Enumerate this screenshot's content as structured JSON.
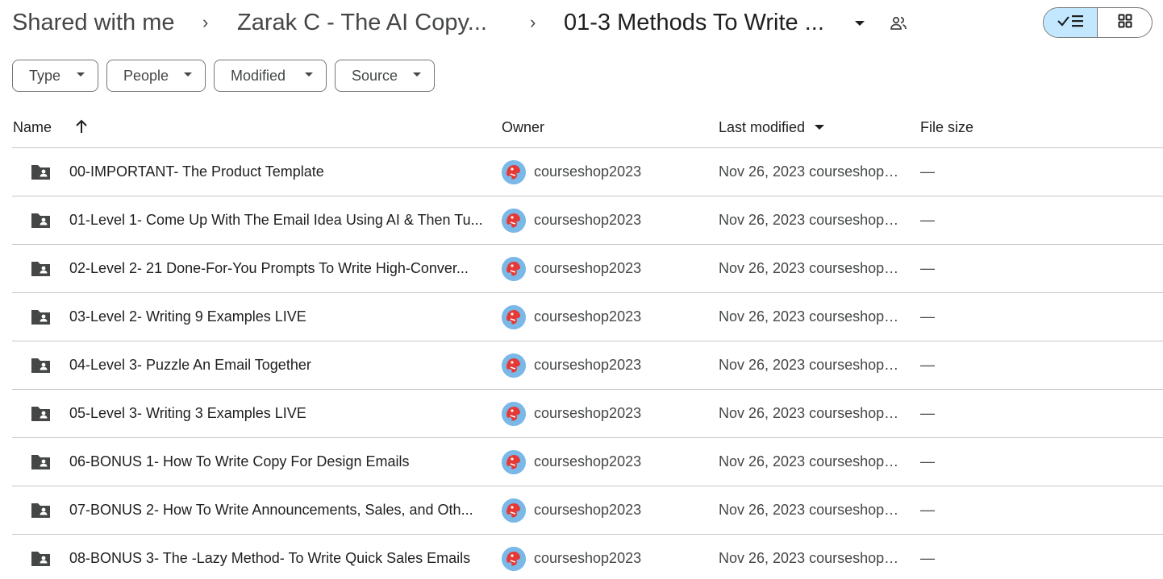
{
  "breadcrumb": {
    "root": "Shared with me",
    "parent": "Zarak C - The AI Copy...",
    "current": "01-3 Methods To Write ...",
    "separator": "›"
  },
  "icons": {
    "crumb_dropdown": "caret-down-icon",
    "share": "people-icon",
    "list_view": "check-list-icon",
    "grid_view": "grid-icon",
    "folder": "shared-folder-icon",
    "sort": "arrow-up-icon"
  },
  "view_mode": "list",
  "filters": [
    {
      "label": "Type"
    },
    {
      "label": "People"
    },
    {
      "label": "Modified"
    },
    {
      "label": "Source"
    }
  ],
  "columns": {
    "name": "Name",
    "owner": "Owner",
    "modified": "Last modified",
    "size": "File size"
  },
  "sort": {
    "column": "Last modified",
    "direction": "descending"
  },
  "rows": [
    {
      "name": "00-IMPORTANT- The Product Template",
      "owner": "courseshop2023",
      "modified": "Nov 26, 2023 courseshop2...",
      "size": "—"
    },
    {
      "name": "01-Level 1- Come Up With The Email Idea Using AI & Then Tu...",
      "owner": "courseshop2023",
      "modified": "Nov 26, 2023 courseshop2...",
      "size": "—"
    },
    {
      "name": "02-Level 2- 21 Done-For-You Prompts To Write High-Conver...",
      "owner": "courseshop2023",
      "modified": "Nov 26, 2023 courseshop2...",
      "size": "—"
    },
    {
      "name": "03-Level 2- Writing 9 Examples LIVE",
      "owner": "courseshop2023",
      "modified": "Nov 26, 2023 courseshop2...",
      "size": "—"
    },
    {
      "name": "04-Level 3- Puzzle An Email Together",
      "owner": "courseshop2023",
      "modified": "Nov 26, 2023 courseshop2...",
      "size": "—"
    },
    {
      "name": "05-Level 3- Writing 3 Examples LIVE",
      "owner": "courseshop2023",
      "modified": "Nov 26, 2023 courseshop2...",
      "size": "—"
    },
    {
      "name": "06-BONUS 1- How To Write Copy For Design Emails",
      "owner": "courseshop2023",
      "modified": "Nov 26, 2023 courseshop2...",
      "size": "—"
    },
    {
      "name": "07-BONUS 2- How To Write Announcements, Sales, and Oth...",
      "owner": "courseshop2023",
      "modified": "Nov 26, 2023 courseshop2...",
      "size": "—"
    },
    {
      "name": "08-BONUS 3- The -Lazy Method- To Write Quick Sales Emails",
      "owner": "courseshop2023",
      "modified": "Nov 26, 2023 courseshop2...",
      "size": "—"
    }
  ],
  "colors": {
    "accent_selected": "#c2e7ff",
    "text_primary": "#1f1f1f",
    "text_secondary": "#444746",
    "divider": "#c7c7c7",
    "avatar_bg": "#7ab8e8"
  }
}
